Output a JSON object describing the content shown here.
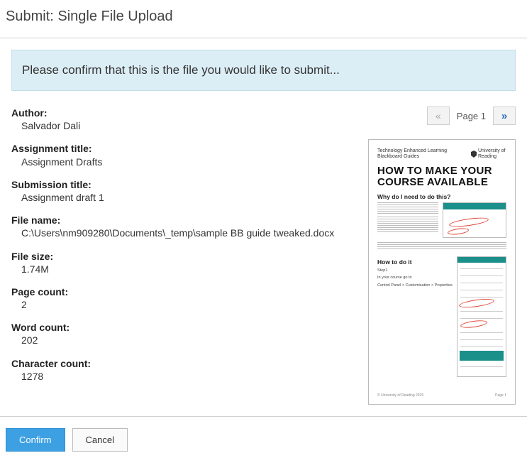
{
  "page": {
    "title": "Submit: Single File Upload",
    "banner": "Please confirm that this is the file you would like to submit..."
  },
  "meta": {
    "author_label": "Author:",
    "author_value": "Salvador Dali",
    "assignment_title_label": "Assignment title:",
    "assignment_title_value": "Assignment Drafts",
    "submission_title_label": "Submission title:",
    "submission_title_value": "Assignment draft 1",
    "file_name_label": "File name:",
    "file_name_value": "C:\\Users\\nm909280\\Documents\\_temp\\sample BB guide tweaked.docx",
    "file_size_label": "File size:",
    "file_size_value": "1.74M",
    "page_count_label": "Page count:",
    "page_count_value": "2",
    "word_count_label": "Word count:",
    "word_count_value": "202",
    "char_count_label": "Character count:",
    "char_count_value": "1278"
  },
  "pager": {
    "prev_glyph": "«",
    "label": "Page 1",
    "next_glyph": "»"
  },
  "preview": {
    "brand_left_line1": "Technology Enhanced Learning",
    "brand_left_line2": "Blackboard Guides",
    "brand_right": "University of Reading",
    "h1_line1": "HOW TO MAKE YOUR",
    "h1_line2": "COURSE AVAILABLE",
    "why_heading": "Why do I need to do this?",
    "howto_heading": "How to do it",
    "step1": "Step1",
    "step1_sub": "In your course go to",
    "step1_nav": "Control Panel > Customisation > Properties"
  },
  "buttons": {
    "confirm": "Confirm",
    "cancel": "Cancel"
  }
}
